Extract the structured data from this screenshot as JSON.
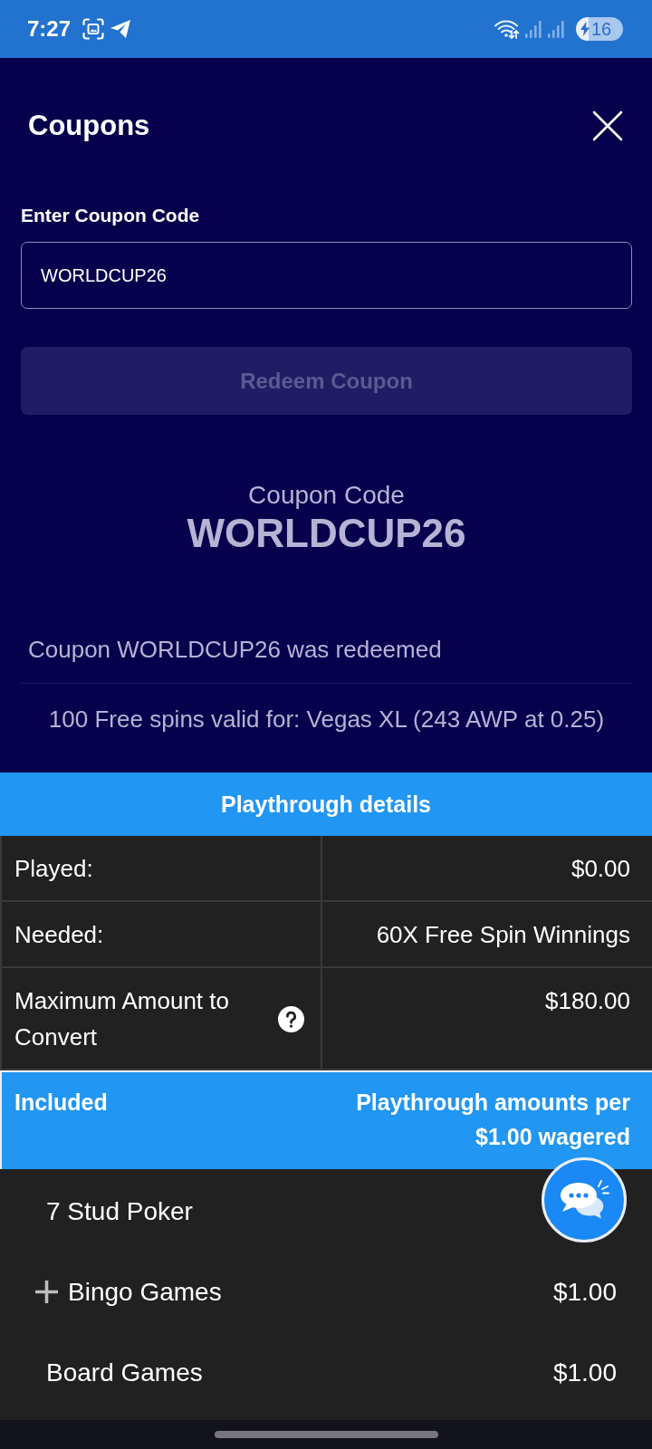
{
  "status_bar": {
    "time": "7:27",
    "battery": "16"
  },
  "header": {
    "title": "Coupons"
  },
  "coupon_form": {
    "label": "Enter Coupon Code",
    "value": "WORLDCUP26",
    "button": {
      "label": "Redeem Coupon",
      "disabled": true
    }
  },
  "coupon_summary": {
    "caption": "Coupon Code",
    "code": "WORLDCUP26"
  },
  "result": {
    "message": "Coupon WORLDCUP26 was redeemed",
    "offer": "100 Free spins valid for: Vegas XL (243 AWP at 0.25)"
  },
  "playthrough": {
    "title": "Playthrough details",
    "rows": [
      {
        "label": "Played:",
        "value": "$0.00",
        "help": false
      },
      {
        "label": "Needed:",
        "value": "60X Free Spin Winnings",
        "help": false
      },
      {
        "label": "Maximum Amount to Convert",
        "value": "$180.00",
        "help": true
      }
    ]
  },
  "included": {
    "columns": [
      "Included",
      "Playthrough amounts per $1.00 wagered"
    ],
    "games": [
      {
        "name": "7 Stud Poker",
        "expandable": false
      },
      {
        "name": "Bingo Games",
        "value": "$1.00",
        "expandable": true
      },
      {
        "name": "Board Games",
        "value": "$1.00",
        "expandable": false
      }
    ]
  }
}
